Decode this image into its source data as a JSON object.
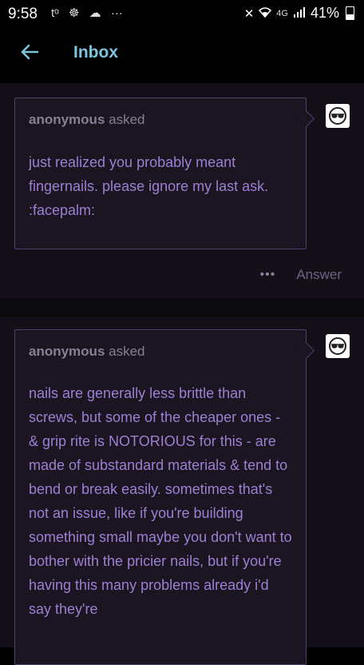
{
  "status_bar": {
    "time": "9:58",
    "left_icons": [
      "messenger-icon",
      "gamepad-icon",
      "cloud-icon",
      "more-dots-icon"
    ],
    "left_icon_text": [
      "tᵒ",
      "☸",
      "☁",
      "···"
    ],
    "network": "4G",
    "battery_percent": "41%"
  },
  "header": {
    "title": "Inbox"
  },
  "messages": [
    {
      "asker": "anonymous",
      "asked_label": "asked",
      "question": "just realized you probably meant fingernails. please ignore my last ask. :facepalm:",
      "more_label": "•••",
      "answer_label": "Answer"
    },
    {
      "asker": "anonymous",
      "asked_label": "asked",
      "question": "nails are generally less brittle than screws, but some of the cheaper ones - & grip rite is NOTORIOUS for this - are made of substandard materials & tend to bend or break easily. sometimes that's not an issue, like if you're building something small maybe you don't want to bother with the pricier nails, but if you're having this many problems already i'd say they're"
    }
  ],
  "colors": {
    "background": "#000000",
    "panel": "#140f19",
    "bubble": "#1a1520",
    "bubble_border": "#4e3f6a",
    "accent_title": "#7cc4dc",
    "question_text": "#9d7fd4",
    "muted_text": "#8a7d96"
  }
}
